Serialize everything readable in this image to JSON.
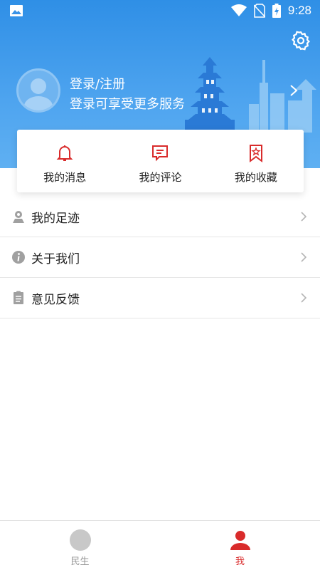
{
  "status_bar": {
    "time": "9:28",
    "icons": [
      "image-icon",
      "wifi-icon",
      "no-sim-icon",
      "battery-charging-icon"
    ]
  },
  "header": {
    "login_title": "登录/注册",
    "login_subtitle": "登录可享受更多服务",
    "settings_icon": "gear-icon",
    "arrow_icon": "chevron-right-icon",
    "colors": {
      "gradient_top": "#2f8fe6",
      "gradient_bottom": "#5fb0f2"
    }
  },
  "quick_actions": [
    {
      "label": "我的消息",
      "icon": "bell-icon"
    },
    {
      "label": "我的评论",
      "icon": "comment-icon"
    },
    {
      "label": "我的收藏",
      "icon": "bookmark-star-icon"
    }
  ],
  "menu": [
    {
      "label": "我的足迹",
      "icon": "location-pin-icon"
    },
    {
      "label": "关于我们",
      "icon": "info-icon"
    },
    {
      "label": "意见反馈",
      "icon": "clipboard-icon"
    }
  ],
  "bottom_nav": [
    {
      "label": "民生",
      "icon": "home-circle-icon",
      "active": false
    },
    {
      "label": "我",
      "icon": "user-icon",
      "active": true
    }
  ],
  "accent_color": "#d92b2b"
}
